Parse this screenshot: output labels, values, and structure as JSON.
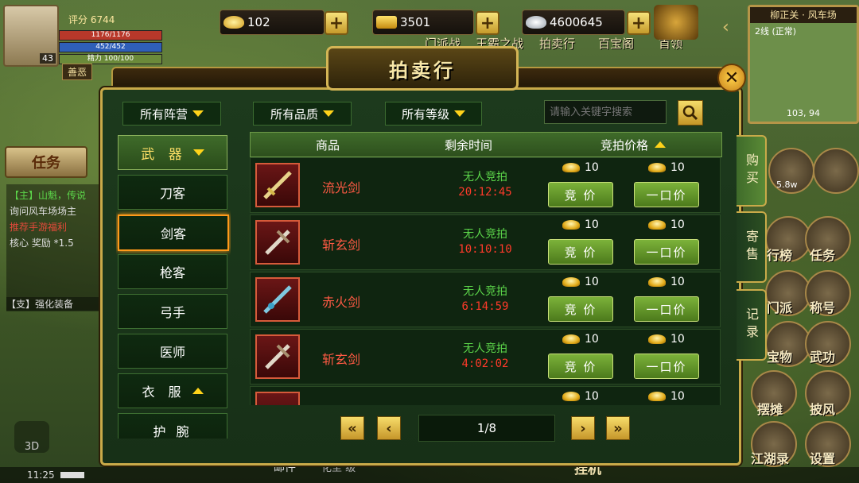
{
  "player": {
    "score_label": "评分 6744",
    "level": "43",
    "hp": "1176/1176",
    "mp": "452/452",
    "stamina": "精力 100/100",
    "tag": "善恶"
  },
  "currency": {
    "gold": "102",
    "gold_bar": "3501",
    "silver": "4600645"
  },
  "top_menu": [
    "门派战",
    "王霸之战",
    "拍卖行",
    "百宝阁",
    "首领"
  ],
  "minimap": {
    "title": "柳正关 · 风车场",
    "line": "2线 (正常)",
    "coords": "103, 94"
  },
  "right_icons": {
    "rank": "行榜",
    "task": "任务",
    "sect": "门派",
    "title": "称号",
    "treasure": "宝物",
    "martial": "武功",
    "stall": "摆摊",
    "cloak": "披风",
    "jianghu": "江湖录",
    "settings": "设置",
    "power": "5.8w"
  },
  "left_ui": {
    "task_tab": "任务",
    "chat_lines": [
      "【主】山魁，传说",
      "询问风车场场主",
      "推荐手游福利",
      "核心 奖励",
      "【支】强化装备"
    ],
    "chat_multiplier": "*1.5",
    "time": "11:25",
    "three_d": "3D"
  },
  "bottom": {
    "mail": "邮件",
    "input_hint": "化至 级",
    "afk": "挂机"
  },
  "dialog": {
    "title": "拍卖行",
    "close": "✕",
    "filters": [
      "所有阵营",
      "所有品质",
      "所有等级"
    ],
    "search_placeholder": "请输入关键字搜索",
    "categories": [
      {
        "label": "武 器",
        "type": "head"
      },
      {
        "label": "刀客"
      },
      {
        "label": "剑客",
        "selected": true
      },
      {
        "label": "枪客"
      },
      {
        "label": "弓手"
      },
      {
        "label": "医师"
      },
      {
        "label": "衣 服",
        "type": "head2"
      },
      {
        "label": "护 腕"
      }
    ],
    "columns": {
      "item": "商品",
      "time": "剩余时间",
      "price": "竞拍价格"
    },
    "status_text": "无人竞拍",
    "bid_label": "竞 价",
    "buyout_label": "一口价",
    "rows": [
      {
        "name": "流光剑",
        "timer": "20:12:45",
        "bid": "10",
        "buyout": "10"
      },
      {
        "name": "斩玄剑",
        "timer": "10:10:10",
        "bid": "10",
        "buyout": "10"
      },
      {
        "name": "赤火剑",
        "timer": "6:14:59",
        "bid": "10",
        "buyout": "10"
      },
      {
        "name": "斩玄剑",
        "timer": "4:02:02",
        "bid": "10",
        "buyout": "10"
      },
      {
        "name": "",
        "timer": "",
        "bid": "10",
        "buyout": "10"
      }
    ],
    "pager": {
      "first": "«",
      "prev": "‹",
      "page": "1/8",
      "next": "›",
      "last": "»"
    },
    "side_tabs": [
      {
        "label": "购买",
        "active": true
      },
      {
        "label": "寄售"
      },
      {
        "label": "记录"
      }
    ]
  }
}
